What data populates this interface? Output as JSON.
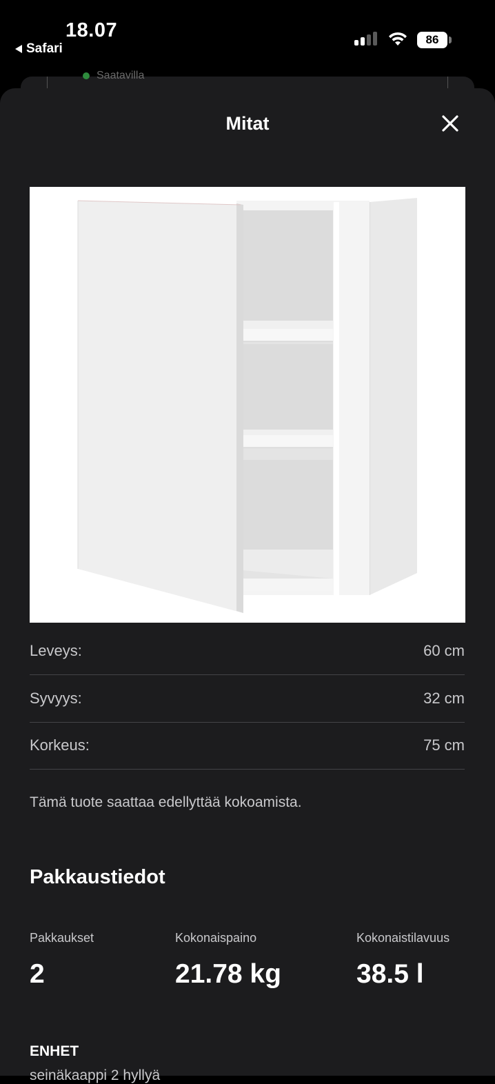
{
  "status_bar": {
    "time": "18.07",
    "back_app": "Safari",
    "battery": "86"
  },
  "underlying_page": {
    "peek_text": "Saatavilla"
  },
  "sheet": {
    "title": "Mitat",
    "close_icon": "close-icon",
    "image_alt": "Seinäkaappi, valkoinen, ovi auki, 2 hyllyä"
  },
  "dimensions": [
    {
      "label": "Leveys:",
      "value": "60 cm"
    },
    {
      "label": "Syvyys:",
      "value": "32 cm"
    },
    {
      "label": "Korkeus:",
      "value": "75 cm"
    }
  ],
  "assembly_note": "Tämä tuote saattaa edellyttää kokoamista.",
  "packaging": {
    "title": "Pakkaustiedot",
    "items": [
      {
        "label": "Pakkaukset",
        "value": "2"
      },
      {
        "label": "Kokonaispaino",
        "value": "21.78 kg"
      },
      {
        "label": "Kokonaistilavuus",
        "value": "38.5 l"
      }
    ]
  },
  "units": {
    "title": "ENHET",
    "peek": "seinäkaappi 2 hyllyä"
  },
  "colors": {
    "sheet_bg": "#1c1c1e",
    "divider": "#444448",
    "available_green": "#2e8b3d"
  }
}
